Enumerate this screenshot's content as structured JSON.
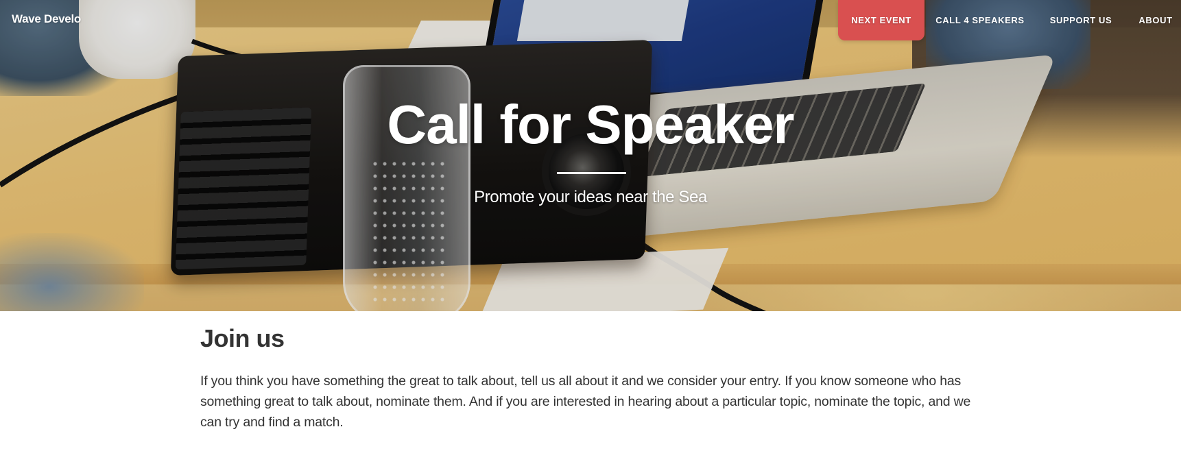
{
  "brand": {
    "name": "Wave Develo"
  },
  "nav": {
    "items": [
      {
        "label": "NEXT EVENT",
        "active": true
      },
      {
        "label": "CALL 4 SPEAKERS",
        "active": false
      },
      {
        "label": "SUPPORT US",
        "active": false
      },
      {
        "label": "ABOUT",
        "active": false
      }
    ],
    "active_color": "#d95050"
  },
  "hero": {
    "title": "Call for Speaker",
    "subtitle": "Promote your ideas near the Sea"
  },
  "join": {
    "heading": "Join us",
    "body": "If you think you have something the great to talk about, tell us all about it and we consider your entry. If you know someone who has something great to talk about, nominate them. And if you are interested in hearing about a particular topic, nominate the topic, and we can try and find a match."
  }
}
